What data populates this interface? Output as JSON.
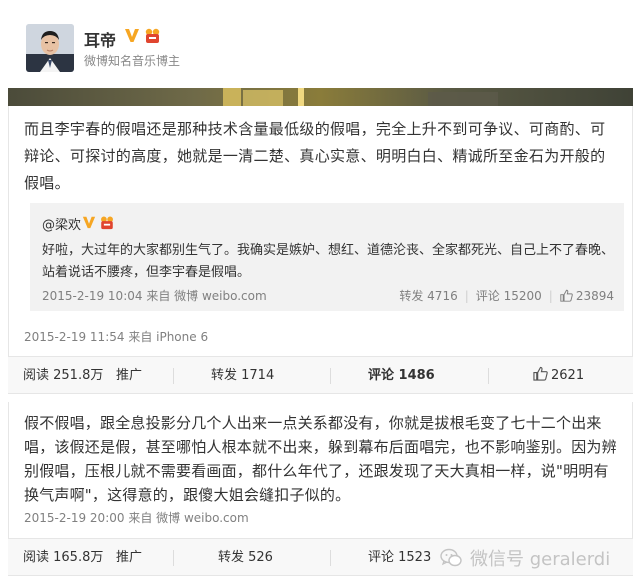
{
  "profile": {
    "name": "耳帝",
    "title": "微博知名音乐博主",
    "avatar_icon": "user-avatar",
    "verified_icon": "verified-v-icon",
    "medal_icon": "member-medal-icon"
  },
  "post": {
    "text": "而且李宇春的假唱还是那种技术含量最低级的假唱，完全上升不到可争议、可商酌、可辩论、可探讨的高度，她就是一清二楚、真心实意、明明白白、精诚所至金石为开般的假唱。",
    "meta": "2015-2-19 11:54 来自 iPhone 6",
    "retweet": {
      "author": "@梁欢",
      "text": "好啦，大过年的大家都别生气了。我确实是嫉妒、想红、道德沦丧、全家都死光、自己上不了春晚、站着说话不腰疼，但李宇春是假唱。",
      "meta": "2015-2-19 10:04 来自 微博 weibo.com",
      "repost": "转发 4716",
      "comment": "评论 15200",
      "likes": "23894"
    },
    "actions": {
      "reads": "阅读 251.8万",
      "promote": "推广",
      "repost": "转发 1714",
      "comment": "评论 1486",
      "likes": "2621"
    }
  },
  "comment": {
    "text": "假不假唱，跟全息投影分几个人出来一点关系都没有，你就是拔根毛变了七十二个出来唱，该假还是假，甚至哪怕人根本就不出来，躲到幕布后面唱完，也不影响鉴别。因为辨别假唱，压根儿就不需要看画面，都什么年代了，还跟发现了天大真相一样，说\"明明有换气声啊\"，这得意的，跟傻大姐会缝扣子似的。",
    "meta": "2015-2-19 20:00 来自 微博 weibo.com",
    "actions": {
      "reads": "阅读 165.8万",
      "promote": "推广",
      "repost": "转发 526",
      "comment": "评论 1523"
    }
  },
  "watermark": {
    "text": "微信号 geralerdi",
    "icon": "wechat-icon"
  },
  "colors": {
    "text": "#333333",
    "meta": "#808080",
    "retweet_bg": "#f2f2f2",
    "actionbar_bg": "#f8f8f8",
    "vip_orange": "#f6a623",
    "medal_red": "#e0452f"
  }
}
